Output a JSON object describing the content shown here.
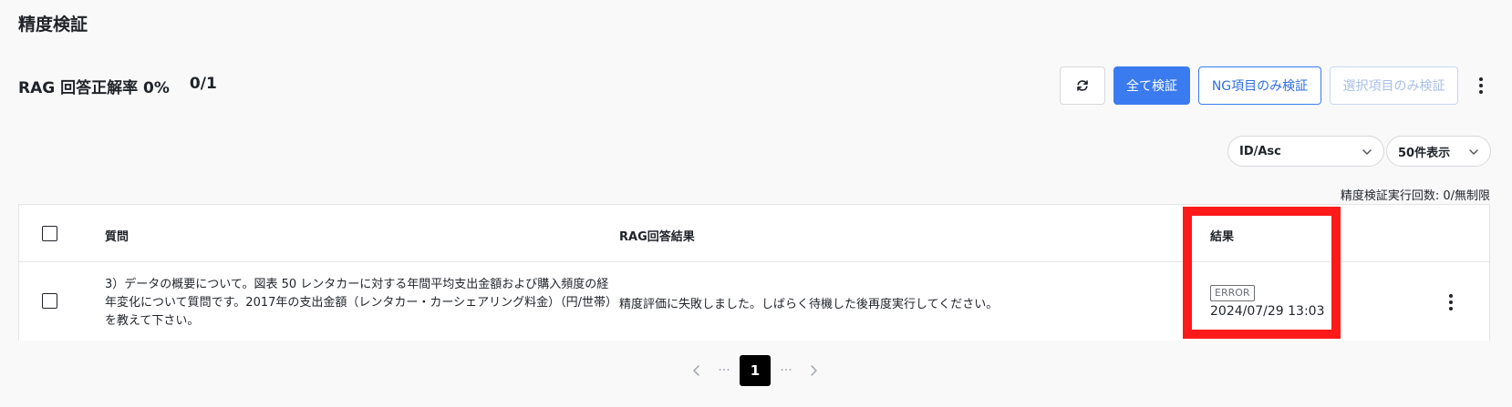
{
  "page": {
    "title": "精度検証",
    "accuracy_label": "RAG 回答正解率 0%",
    "accuracy_count": "0/1"
  },
  "toolbar": {
    "refresh_icon": "refresh-icon",
    "verify_all_label": "全て検証",
    "verify_ng_label": "NG項目のみ検証",
    "verify_selected_label": "選択項目のみ検証",
    "more_icon": "kebab-icon"
  },
  "filters": {
    "sort_value": "ID/Asc",
    "page_size_value": "50件表示"
  },
  "exec_count": "精度検証実行回数: 0/無制限",
  "table": {
    "headers": {
      "question": "質問",
      "rag_result": "RAG回答結果",
      "result": "結果"
    },
    "rows": [
      {
        "question": "3）データの概要について。図表 50 レンタカーに対する年間平均支出金額および購入頻度の経年変化について質問です。2017年の支出金額（レンタカー・カーシェアリング料金）（円/世帯）を教えて下さい。",
        "rag_result": "精度評価に失敗しました。しばらく待機した後再度実行してください。",
        "status": "ERROR",
        "timestamp": "2024/07/29 13:03"
      }
    ]
  },
  "pagination": {
    "ellipsis_left": "···",
    "current_page": "1",
    "ellipsis_right": "···"
  },
  "colors": {
    "primary": "#3b7bf0",
    "highlight": "#ff1a1a",
    "background": "#f9f9fa"
  }
}
